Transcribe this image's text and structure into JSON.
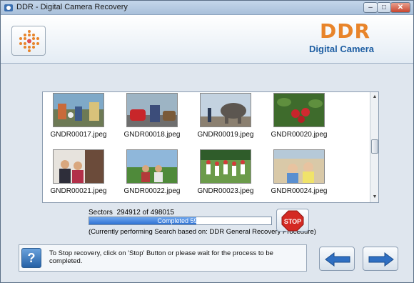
{
  "window": {
    "title": "DDR - Digital Camera Recovery",
    "controls": {
      "minimize": "–",
      "maximize": "□",
      "close": "✕"
    }
  },
  "header": {
    "brand": "DDR",
    "subtitle": "Digital Camera",
    "brand_color": "#e8842a",
    "subtitle_color": "#1f5fa3"
  },
  "thumbnails": [
    {
      "name": "GNDR00017.jpeg",
      "icon": "photo-parade-icon"
    },
    {
      "name": "GNDR00018.jpeg",
      "icon": "photo-cars-icon"
    },
    {
      "name": "GNDR00019.jpeg",
      "icon": "photo-elephant-icon"
    },
    {
      "name": "GNDR00020.jpeg",
      "icon": "photo-strawberries-icon"
    },
    {
      "name": "GNDR00021.jpeg",
      "icon": "photo-family-icon"
    },
    {
      "name": "GNDR00022.jpeg",
      "icon": "photo-park-icon"
    },
    {
      "name": "GNDR00023.jpeg",
      "icon": "photo-children-icon"
    },
    {
      "name": "GNDR00024.jpeg",
      "icon": "photo-babies-icon"
    }
  ],
  "progress": {
    "sectors_label": "Sectors",
    "sectors_value": "294912 of 498015",
    "completed_text": "Completed 59%",
    "fraction": 0.59,
    "procedure_text": "(Currently performing Search based on:  DDR General Recovery Procedure)",
    "stop_label": "STOP"
  },
  "footer": {
    "help_label": "?",
    "hint": "To Stop recovery, click on 'Stop' Button or please wait for the process to be completed."
  }
}
